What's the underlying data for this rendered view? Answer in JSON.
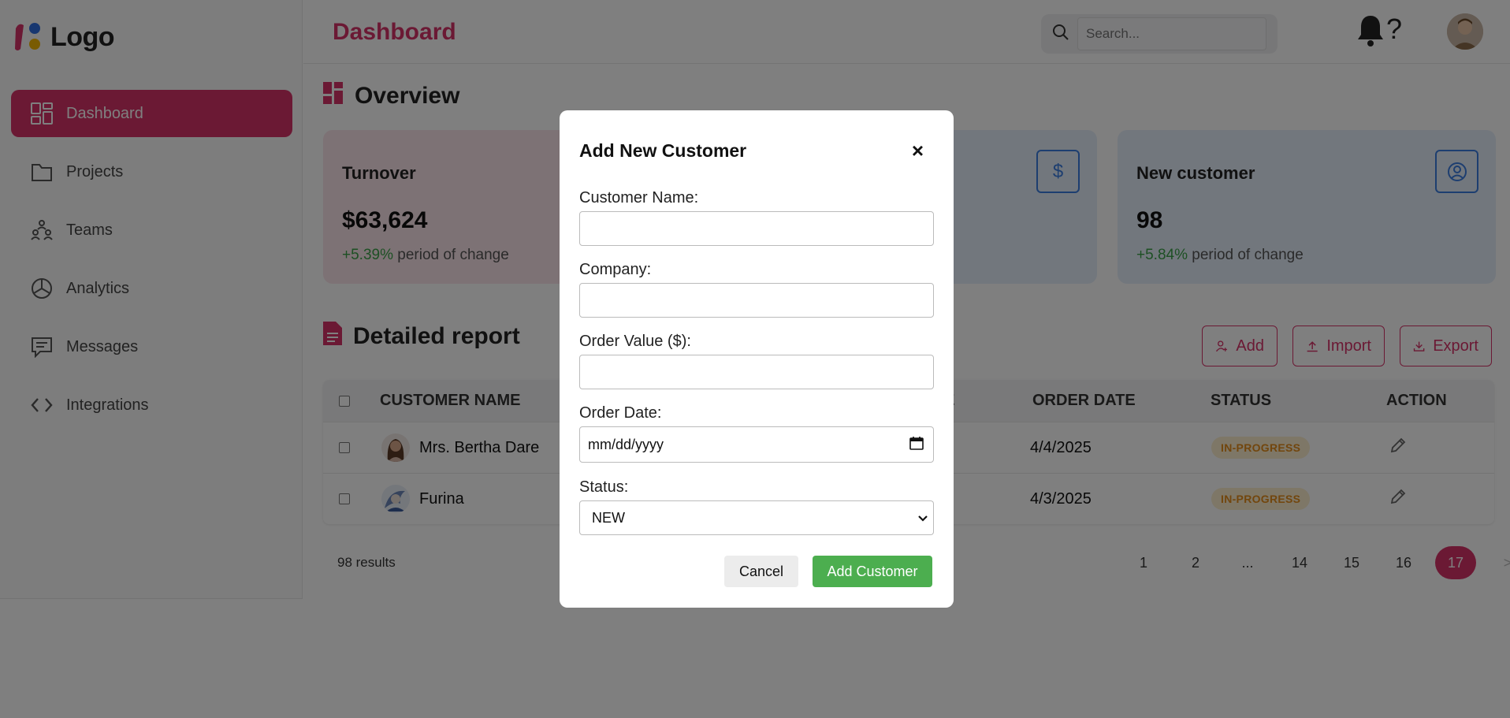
{
  "app": {
    "logo_text": "Logo",
    "page_title": "Dashboard"
  },
  "sidebar": {
    "items": [
      {
        "label": "Dashboard",
        "icon": "dashboard-icon",
        "active": true
      },
      {
        "label": "Projects",
        "icon": "folder-icon"
      },
      {
        "label": "Teams",
        "icon": "teams-icon"
      },
      {
        "label": "Analytics",
        "icon": "pie-chart-icon"
      },
      {
        "label": "Messages",
        "icon": "message-icon"
      },
      {
        "label": "Integrations",
        "icon": "code-icon"
      }
    ]
  },
  "header": {
    "search_placeholder": "Search...",
    "help_label": "?"
  },
  "overview": {
    "title": "Overview",
    "cards": [
      {
        "title": "Turnover",
        "value": "$63,624",
        "change": "+5.39%",
        "change_suffix": "period of change"
      },
      {
        "title": "",
        "value": "",
        "change": "",
        "change_suffix": "",
        "icon_glyph": "$"
      },
      {
        "title": "New customer",
        "value": "98",
        "change": "+5.84%",
        "change_suffix": "period of change"
      }
    ]
  },
  "report": {
    "title": "Detailed report",
    "actions": {
      "add": "Add",
      "import": "Import",
      "export": "Export"
    },
    "columns": {
      "customer": "CUSTOMER NAME",
      "partial": "E",
      "order_date": "ORDER DATE",
      "status": "STATUS",
      "action": "ACTION"
    },
    "rows": [
      {
        "name": "Mrs. Bertha Dare",
        "order_date": "4/4/2025",
        "status": "IN-PROGRESS"
      },
      {
        "name": "Furina",
        "order_date": "4/3/2025",
        "status": "IN-PROGRESS"
      }
    ],
    "results": "98 results",
    "pages": [
      "1",
      "2",
      "...",
      "14",
      "15",
      "16",
      "17"
    ],
    "current_page": "17",
    "next_label": ">"
  },
  "modal": {
    "title": "Add New Customer",
    "close": "×",
    "fields": {
      "name_label": "Customer Name:",
      "company_label": "Company:",
      "value_label": "Order Value ($):",
      "date_label": "Order Date:",
      "date_placeholder": "mm/dd/yyyy",
      "status_label": "Status:",
      "status_value": "NEW"
    },
    "cancel": "Cancel",
    "submit": "Add Customer"
  },
  "colors": {
    "brand": "#d63268",
    "success": "#4cae4f",
    "positive": "#3aa049",
    "warning": "#e48c1a"
  }
}
